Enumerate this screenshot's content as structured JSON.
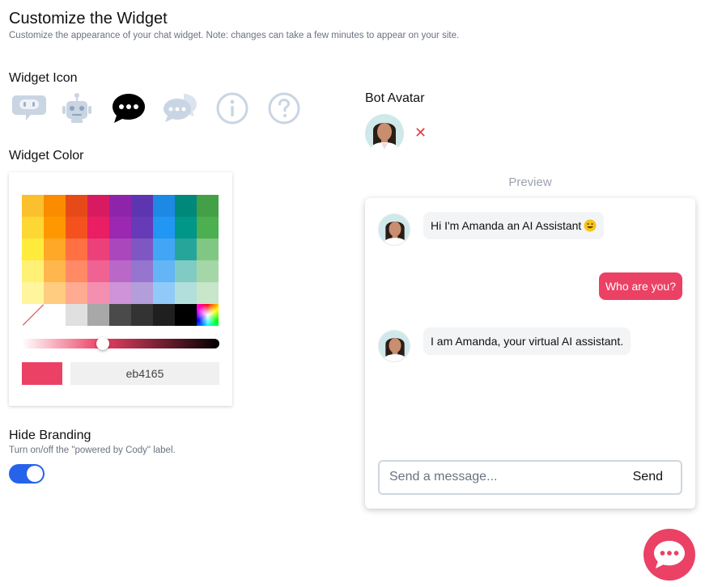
{
  "header": {
    "title": "Customize the Widget",
    "subtitle": "Customize the appearance of your chat widget. Note: changes can take a few minutes to appear on your site."
  },
  "widget_icon": {
    "label": "Widget Icon",
    "options": [
      "robot-face-bubble-icon",
      "robot-icon",
      "chat-dots-icon",
      "chat-double-bubble-icon",
      "info-circle-icon",
      "question-circle-icon"
    ],
    "selected": "chat-dots-icon"
  },
  "widget_color": {
    "label": "Widget Color",
    "swatches": [
      "#fbc02d",
      "#fb8c00",
      "#e64a19",
      "#d81b60",
      "#8e24aa",
      "#5e35b1",
      "#1e88e5",
      "#00897b",
      "#43a047",
      "#fdd835",
      "#ff9800",
      "#f4511e",
      "#e91e63",
      "#9c27b0",
      "#673ab7",
      "#2196f3",
      "#009688",
      "#4caf50",
      "#ffeb3b",
      "#ffa726",
      "#ff7043",
      "#ec407a",
      "#ab47bc",
      "#7e57c2",
      "#42a5f5",
      "#26a69a",
      "#81c784",
      "#fff176",
      "#ffb74d",
      "#ff8a65",
      "#f06292",
      "#ba68c8",
      "#9575cd",
      "#64b5f6",
      "#80cbc4",
      "#a5d6a7",
      "#fff59d",
      "#ffcc80",
      "#ffab91",
      "#f48fb1",
      "#ce93d8",
      "#b39ddb",
      "#90caf9",
      "#b2dfdb",
      "#c8e6c9",
      "none",
      "#ffffff",
      "#e0e0e0",
      "#a8a8a8",
      "#4a4a4a",
      "#333333",
      "#1f1f1f",
      "#000000",
      "rainbow"
    ],
    "slider_position": 0.41,
    "current_color": "#eb4165",
    "hex_value": "eb4165"
  },
  "branding": {
    "label": "Hide Branding",
    "description": "Turn on/off the \"powered by Cody\" label.",
    "enabled": true
  },
  "bot_avatar": {
    "label": "Bot Avatar",
    "remove_glyph": "✕"
  },
  "preview": {
    "label": "Preview",
    "messages": [
      {
        "from": "bot",
        "text": "Hi I'm Amanda an AI Assistant"
      },
      {
        "from": "user",
        "text": "Who are you?"
      },
      {
        "from": "bot",
        "text": "I am Amanda, your virtual AI assistant."
      }
    ],
    "input_placeholder": "Send a message...",
    "send_label": "Send"
  },
  "colors": {
    "accent": "#eb4165",
    "toggle_on": "#2563eb",
    "bubble_bot": "#f3f4f6"
  }
}
